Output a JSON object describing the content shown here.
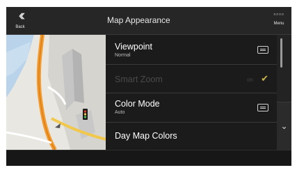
{
  "topbar": {
    "back_label": "Back",
    "back_icon": "double-chevron-left-icon",
    "title": "Map Appearance",
    "menu_label": "Menu",
    "menu_icon": "grid-dots-icon"
  },
  "list": {
    "items": [
      {
        "title": "Viewpoint",
        "subtitle": "Normal",
        "icon": "list-icon"
      },
      {
        "title": "Smart Zoom",
        "state": "on",
        "icon": "check-icon",
        "enabled": false
      },
      {
        "title": "Color Mode",
        "subtitle": "Auto",
        "icon": "list-icon"
      },
      {
        "title": "Day Map Colors"
      }
    ]
  },
  "scroll": {
    "down_icon": "chevron-down-icon"
  },
  "colors": {
    "accent": "#c9b64a",
    "background": "#1e1e1e",
    "road_primary": "#f39b2d",
    "road_secondary": "#f2c84a"
  }
}
